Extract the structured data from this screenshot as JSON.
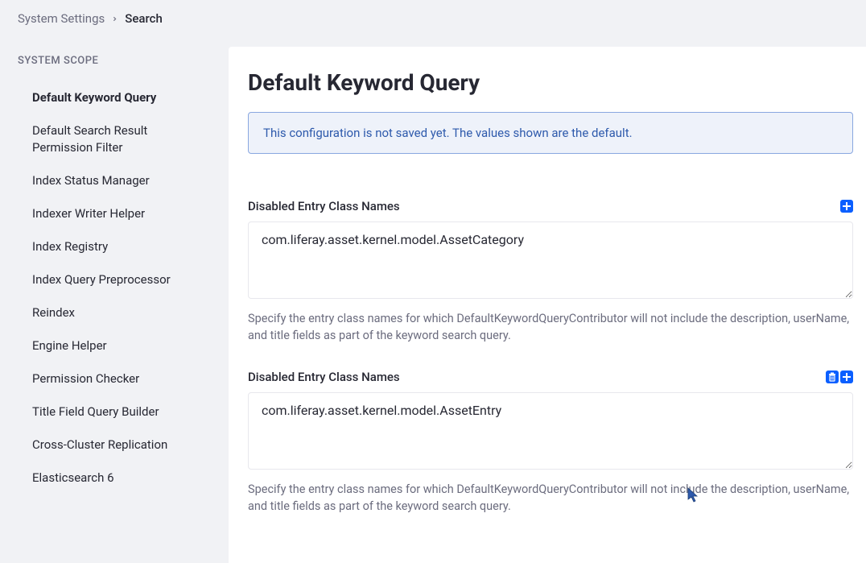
{
  "breadcrumb": {
    "parent": "System Settings",
    "current": "Search"
  },
  "sidebar": {
    "header": "SYSTEM SCOPE",
    "items": [
      {
        "label": "Default Keyword Query",
        "active": true
      },
      {
        "label": "Default Search Result Permission Filter",
        "active": false
      },
      {
        "label": "Index Status Manager",
        "active": false
      },
      {
        "label": "Indexer Writer Helper",
        "active": false
      },
      {
        "label": "Index Registry",
        "active": false
      },
      {
        "label": "Index Query Preprocessor",
        "active": false
      },
      {
        "label": "Reindex",
        "active": false
      },
      {
        "label": "Engine Helper",
        "active": false
      },
      {
        "label": "Permission Checker",
        "active": false
      },
      {
        "label": "Title Field Query Builder",
        "active": false
      },
      {
        "label": "Cross-Cluster Replication",
        "active": false
      },
      {
        "label": "Elasticsearch 6",
        "active": false
      }
    ]
  },
  "main": {
    "title": "Default Keyword Query",
    "banner": "This configuration is not saved yet. The values shown are the default.",
    "fields": [
      {
        "label": "Disabled Entry Class Names",
        "value": "com.liferay.asset.kernel.model.AssetCategory",
        "help": "Specify the entry class names for which DefaultKeywordQueryContributor will not include the description, userName, and title fields as part of the keyword search query.",
        "show_delete": false
      },
      {
        "label": "Disabled Entry Class Names",
        "value": "com.liferay.asset.kernel.model.AssetEntry",
        "help": "Specify the entry class names for which DefaultKeywordQueryContributor will not include the description, userName, and title fields as part of the keyword search query.",
        "show_delete": true
      }
    ]
  },
  "colors": {
    "accent": "#0b5fff"
  }
}
